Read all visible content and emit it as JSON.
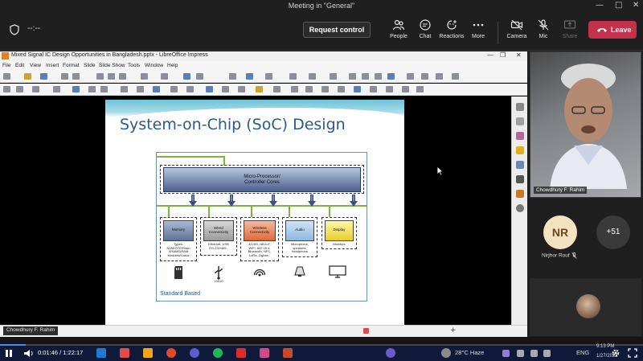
{
  "window": {
    "title": "Meeting in \"General\""
  },
  "meeting": {
    "timer": "--:--",
    "request_control": "Request control",
    "controls": [
      {
        "id": "people",
        "label": "People",
        "icon": "people-icon"
      },
      {
        "id": "chat",
        "label": "Chat",
        "icon": "chat-icon"
      },
      {
        "id": "reactions",
        "label": "Reactions",
        "icon": "reactions-icon"
      },
      {
        "id": "more",
        "label": "More",
        "icon": "more-icon"
      },
      {
        "id": "camera",
        "label": "Camera",
        "icon": "camera-off-icon"
      },
      {
        "id": "mic",
        "label": "Mic",
        "icon": "mic-off-icon"
      },
      {
        "id": "share",
        "label": "Share",
        "icon": "share-icon"
      }
    ],
    "leave": "Leave"
  },
  "libreoffice": {
    "title": "Mixed Signal IC Design Opportunities in Bangladesh.pptx - LibreOffice Impress",
    "menu": [
      "File",
      "Edit",
      "View",
      "Insert",
      "Format",
      "Slide",
      "Slide Show",
      "Tools",
      "Window",
      "Help"
    ]
  },
  "slide": {
    "title": "System-on-Chip (SoC) Design",
    "cpu": [
      "Micro-Processor/",
      "Controller Cores"
    ],
    "modules": [
      {
        "name": "Memory",
        "desc": [
          "Types:",
          "NVM/OTP/Flash",
          "SRAM/DRAM",
          "Modules/Cards"
        ]
      },
      {
        "name": "Wired Connectivity",
        "desc": [
          "Ethernet, USB",
          "RS-232/485.."
        ]
      },
      {
        "name": "Wireless Connectivity",
        "desc": [
          "4G/5G, NB-IoT,",
          "WiFi, 802.15.4,",
          "Bluetooth, NFC,",
          "LoRa, Zigbee.."
        ]
      },
      {
        "name": "Audio",
        "desc": [
          "Microphone,",
          "speakers,",
          "headphone"
        ]
      },
      {
        "name": "Display",
        "desc": [
          "Monitors"
        ]
      }
    ],
    "usb_label": "10010",
    "footer": "Standard Based"
  },
  "presenter": "Chowdhury F. Rahim",
  "participants": {
    "video_name": "Chowdhury F. Rahim",
    "avatar_initials": "NR",
    "avatar_name": "Nirjhor Rouf",
    "overflow": "+51"
  },
  "media": {
    "time": "0:01:46 / 1:22:17"
  },
  "taskbar": {
    "weather": "28°C  Haze",
    "lang": "ENG",
    "clock": "9:13 PM",
    "date": "1/27/2022"
  },
  "colors": {
    "leave": "#c4314b",
    "title": "#2a5a8a",
    "accent": "#7cb342"
  }
}
